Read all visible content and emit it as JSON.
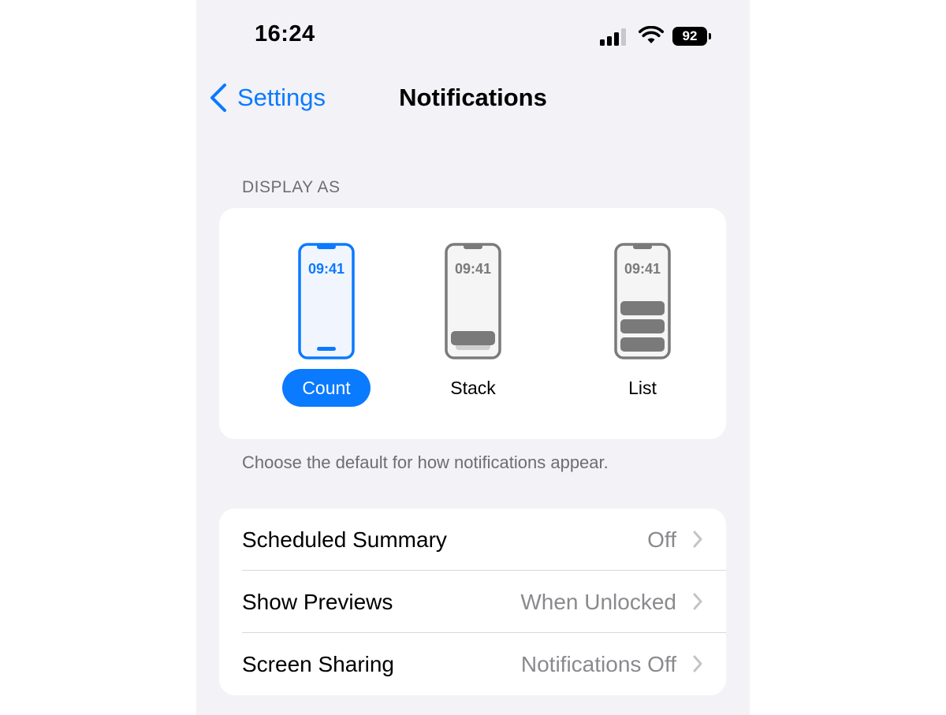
{
  "status_bar": {
    "time": "16:24",
    "battery": "92"
  },
  "nav": {
    "back_label": "Settings",
    "title": "Notifications"
  },
  "display_as": {
    "header": "DISPLAY AS",
    "preview_time": "09:41",
    "options": [
      {
        "label": "Count",
        "selected": true
      },
      {
        "label": "Stack",
        "selected": false
      },
      {
        "label": "List",
        "selected": false
      }
    ],
    "footer": "Choose the default for how notifications appear."
  },
  "settings_rows": [
    {
      "label": "Scheduled Summary",
      "value": "Off"
    },
    {
      "label": "Show Previews",
      "value": "When Unlocked"
    },
    {
      "label": "Screen Sharing",
      "value": "Notifications Off"
    }
  ],
  "colors": {
    "accent": "#0a7aff",
    "background": "#f2f2f7",
    "secondary_text": "#8a8a8e",
    "icon_gray": "#7a7a7a"
  }
}
